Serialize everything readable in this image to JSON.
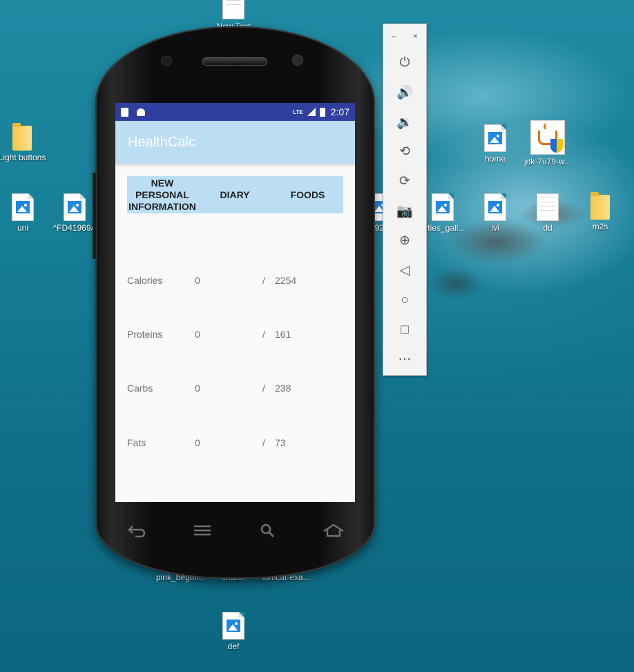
{
  "desktop": {
    "icons": [
      {
        "label": "New Text",
        "type": "text"
      },
      {
        "label": "Light buttons",
        "type": "folder"
      },
      {
        "label": "uni",
        "type": "image"
      },
      {
        "label": "^FD41969A",
        "type": "image"
      },
      {
        "label": "home",
        "type": "image"
      },
      {
        "label": "jdk-7u79-w...",
        "type": "java"
      },
      {
        "label": "92",
        "type": "image"
      },
      {
        "label": "arties_gall...",
        "type": "image"
      },
      {
        "label": "ivi",
        "type": "image"
      },
      {
        "label": "dd",
        "type": "text"
      },
      {
        "label": "m2s",
        "type": "folder"
      },
      {
        "label": "pink_begon...",
        "type": "image"
      },
      {
        "label": "слажи",
        "type": "image"
      },
      {
        "label": "tomcat-exa...",
        "type": "image"
      },
      {
        "label": "def",
        "type": "image"
      }
    ]
  },
  "phone": {
    "status": {
      "time": "2:07",
      "network": "LTE"
    },
    "app": {
      "title": "HealthCalc",
      "tabs": [
        {
          "label": "NEW PERSONAL INFORMATION"
        },
        {
          "label": "DIARY"
        },
        {
          "label": "FOODS"
        }
      ],
      "nutrients": [
        {
          "label": "Calories",
          "value": "0",
          "sep": "/",
          "goal": "2254"
        },
        {
          "label": "Proteins",
          "value": "0",
          "sep": "/",
          "goal": "161"
        },
        {
          "label": "Carbs",
          "value": "0",
          "sep": "/",
          "goal": "238"
        },
        {
          "label": "Fats",
          "value": "0",
          "sep": "/",
          "goal": "73"
        }
      ]
    },
    "nav_keys": [
      "back-icon",
      "menu-icon",
      "search-icon",
      "home-icon"
    ]
  },
  "emulator_toolbar": {
    "window_controls": {
      "minimize": "–",
      "close": "×"
    },
    "buttons": [
      {
        "name": "power-icon",
        "glyph": "⏻"
      },
      {
        "name": "volume-up-icon",
        "glyph": "🔊"
      },
      {
        "name": "volume-down-icon",
        "glyph": "🔉"
      },
      {
        "name": "rotate-left-icon",
        "glyph": "⟲"
      },
      {
        "name": "rotate-right-icon",
        "glyph": "⟳"
      },
      {
        "name": "camera-icon",
        "glyph": "📷"
      },
      {
        "name": "zoom-icon",
        "glyph": "⊕"
      },
      {
        "name": "back-icon",
        "glyph": "◁"
      },
      {
        "name": "home-icon",
        "glyph": "○"
      },
      {
        "name": "overview-icon",
        "glyph": "□"
      },
      {
        "name": "more-icon",
        "glyph": "⋯"
      }
    ]
  }
}
